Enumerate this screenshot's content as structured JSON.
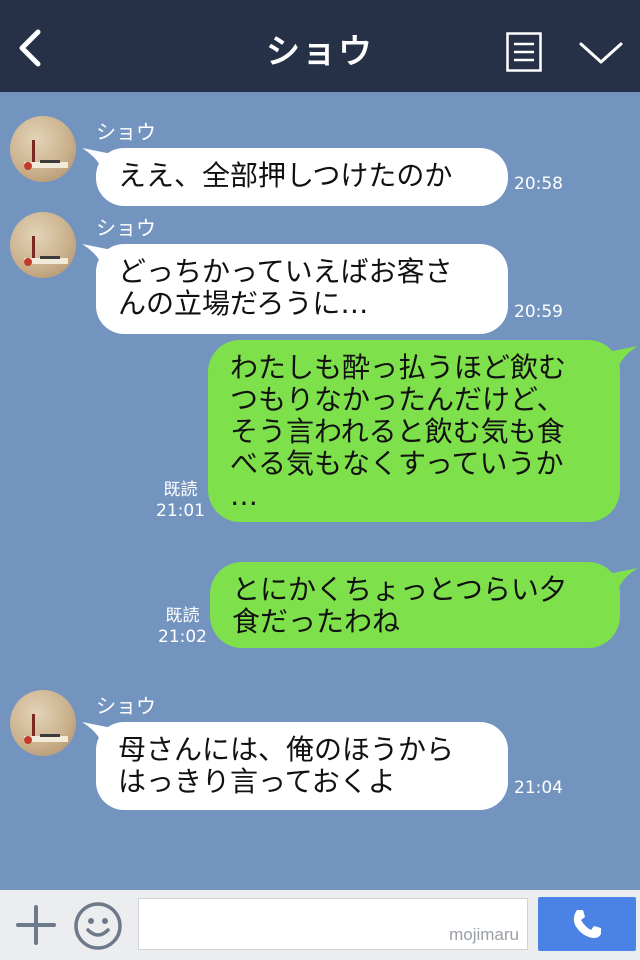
{
  "header": {
    "title": "ショウ"
  },
  "messages": [
    {
      "side": "left",
      "sender": "ショウ",
      "text": "ええ、全部押しつけたのか",
      "time": "20:58"
    },
    {
      "side": "left",
      "sender": "ショウ",
      "text": "どっちかっていえばお客さ\nんの立場だろうに…",
      "time": "20:59"
    },
    {
      "side": "right",
      "read": "既読",
      "text": "わたしも酔っ払うほど飲む\nつもりなかったんだけど、\nそう言われると飲む気も食\nべる気もなくすっていうか\n…",
      "time": "21:01"
    },
    {
      "side": "right",
      "read": "既読",
      "text": "とにかくちょっとつらい夕\n食だったわね",
      "time": "21:02"
    },
    {
      "side": "left",
      "sender": "ショウ",
      "text": "母さんには、俺のほうから\nはっきり言っておくよ",
      "time": "21:04"
    }
  ],
  "footer": {
    "watermark": "mojimaru"
  },
  "colors": {
    "background": "#7494c0",
    "header": "#263148",
    "own_bubble": "#7ee04a",
    "send_button": "#4a82e6"
  }
}
